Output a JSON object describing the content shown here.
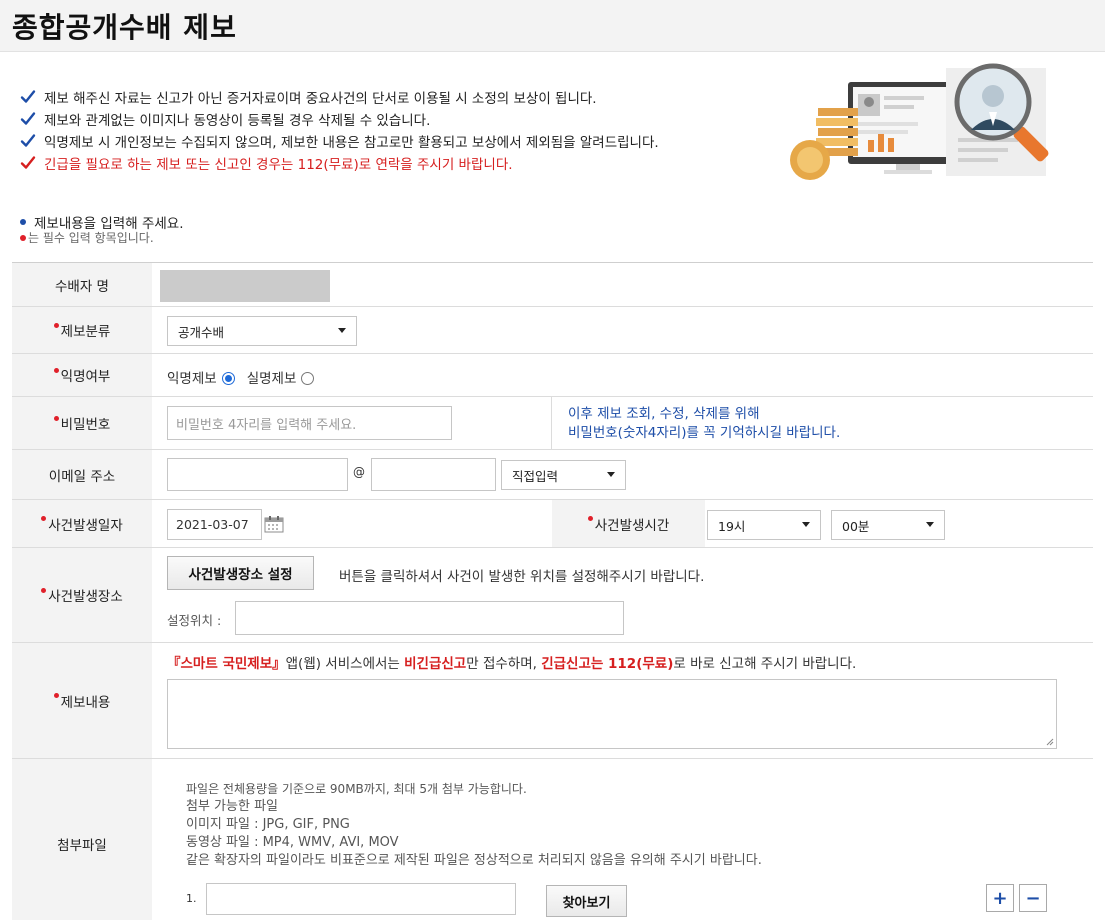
{
  "page": {
    "title": "종합공개수배 제보"
  },
  "notices": [
    {
      "text": "제보 해주신 자료는 신고가 아닌 증거자료이며 중요사건의 단서로 이용될 시 소정의 보상이 됩니다.",
      "type": "normal"
    },
    {
      "text": "제보와 관계없는 이미지나 동영상이 등록될 경우 삭제될 수 있습니다.",
      "type": "normal"
    },
    {
      "text": "익명제보 시 개인정보는 수집되지 않으며, 제보한 내용은 참고로만 활용되고 보상에서 제외됨을 알려드립니다.",
      "type": "normal"
    },
    {
      "text": "긴급을 필요로 하는 제보 또는 신고인 경우는 112(무료)로 연락을 주시기 바랍니다.",
      "type": "urgent"
    }
  ],
  "guide": {
    "line1": "제보내용을 입력해 주세요.",
    "line2": "는 필수 입력 항목입니다."
  },
  "form": {
    "wanted_name": {
      "label": "수배자 명"
    },
    "category": {
      "label": "제보분류",
      "value": "공개수배"
    },
    "anonymity": {
      "label": "익명여부",
      "option_anonymous": "익명제보",
      "option_named": "실명제보",
      "selected": "익명제보"
    },
    "password": {
      "label": "비밀번호",
      "placeholder": "비밀번호 4자리를 입력해 주세요.",
      "hint_line1": "이후 제보 조회, 수정, 삭제를 위해",
      "hint_line2": "비밀번호(숫자4자리)를 꼭 기억하시길 바랍니다."
    },
    "email": {
      "label": "이메일 주소",
      "at": "@",
      "domain_select": "직접입력"
    },
    "incident_date": {
      "label": "사건발생일자",
      "value": "2021-03-07"
    },
    "incident_time": {
      "label": "사건발생시간",
      "hour": "19시",
      "minute": "00분"
    },
    "incident_place": {
      "label": "사건발생장소",
      "button": "사건발생장소 설정",
      "instruction": "버튼을 클릭하셔서 사건이 발생한 위치를 설정해주시기 바랍니다.",
      "location_label": "설정위치 :"
    },
    "content": {
      "label": "제보내용",
      "notice_service": "『스마트 국민제보』",
      "notice_mid1": "앱(웹) 서비스에서는 ",
      "notice_nonurgent": "비긴급신고",
      "notice_mid2": "만 접수하며, ",
      "notice_urgent": "긴급신고는 112(무료)",
      "notice_end": "로 바로 신고해 주시기 바랍니다."
    },
    "attachment": {
      "label": "첨부파일",
      "limit": "파일은 전체용량을 기준으로 90MB까지, 최대 5개 첨부 가능합니다.",
      "allowed_title": "첨부 가능한 파일",
      "image_types": "이미지 파일 : JPG, GIF, PNG",
      "video_types": "동영상 파일 : MP4, WMV, AVI, MOV",
      "warning": "같은 확장자의 파일이라도 비표준으로 제작된 파일은 정상적으로 처리되지 않음을 유의해 주시기 바랍니다.",
      "file_index": "1.",
      "browse_button": "찾아보기",
      "add_symbol": "+",
      "remove_symbol": "−"
    }
  },
  "colors": {
    "accent_blue": "#1e4ea8",
    "required_red": "#e0202a",
    "urgent_red": "#d61f1f",
    "label_bg": "#f3f3f3"
  },
  "icons": {
    "check": "checkmark-icon",
    "calendar": "calendar-icon",
    "dropdown": "chevron-down-icon"
  }
}
